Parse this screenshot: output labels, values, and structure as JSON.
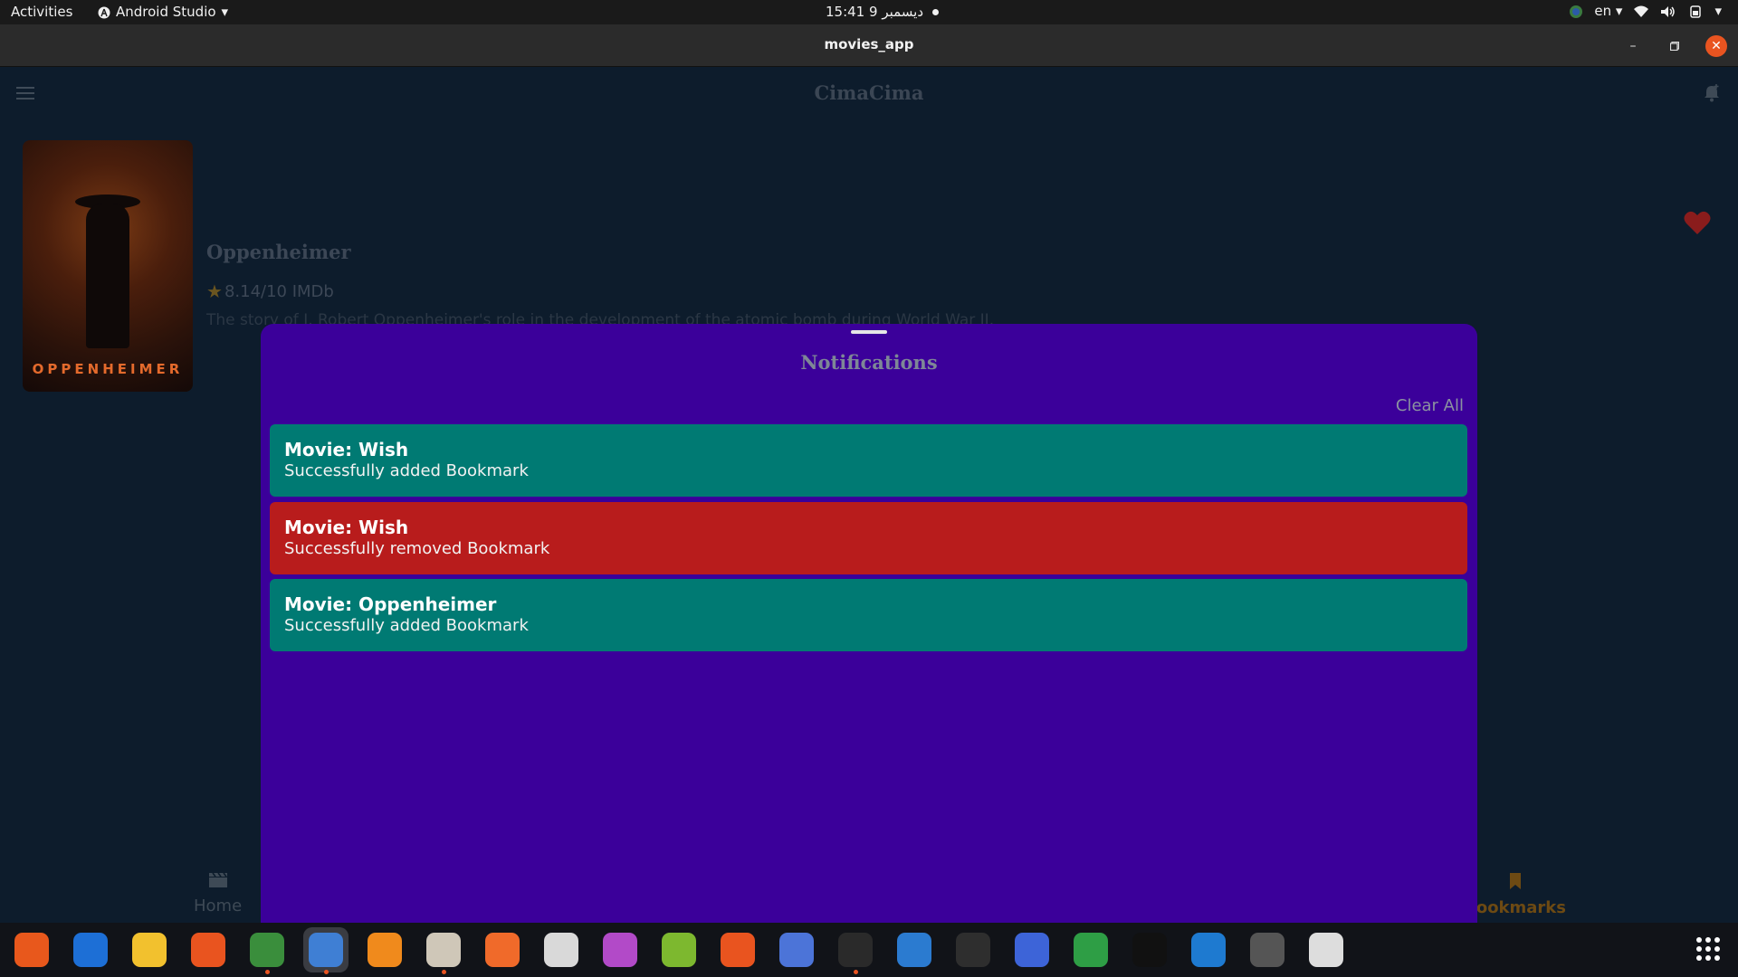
{
  "topbar": {
    "activities": "Activities",
    "app_menu": "Android Studio",
    "clock": "15:41  9 ديسمبر",
    "lang": "en"
  },
  "window": {
    "title": "movies_app"
  },
  "app": {
    "title": "CimaCima",
    "movie": {
      "title": "Oppenheimer",
      "rating": "8.14/10 IMDb",
      "description": "The story of J. Robert Oppenheimer's role in the development of the atomic bomb during World War II.",
      "poster_text": "OPPENHEIMER"
    },
    "nav": {
      "home": "Home",
      "bookmarks": "Bookmarks"
    }
  },
  "sheet": {
    "title": "Notifications",
    "clear_all": "Clear All",
    "notifications": [
      {
        "title": "Movie: Wish",
        "message": "Successfully added Bookmark",
        "type": "added"
      },
      {
        "title": "Movie: Wish",
        "message": "Successfully removed Bookmark",
        "type": "removed"
      },
      {
        "title": "Movie: Oppenheimer",
        "message": "Successfully added Bookmark",
        "type": "added"
      }
    ]
  },
  "colors": {
    "app_bg": "#0d1c2c",
    "sheet_bg": "#3b009a",
    "added": "#007a73",
    "removed": "#b81c1c",
    "heart": "#8a1c1c",
    "bookmark_active": "#6d4a13"
  },
  "dock": {
    "apps": [
      {
        "icon": "firefox-icon",
        "bg": "#e8581c"
      },
      {
        "icon": "thunderbird-icon",
        "bg": "#1d6fd6"
      },
      {
        "icon": "rhythmbox-icon",
        "bg": "#f2c12e"
      },
      {
        "icon": "software-center-icon",
        "bg": "#e9541f"
      },
      {
        "icon": "chrome-icon",
        "bg": "#3a8e3c"
      },
      {
        "icon": "android-studio-icon",
        "bg": "#3f7fd4"
      },
      {
        "icon": "vlc-icon",
        "bg": "#f08a1c"
      },
      {
        "icon": "files-icon",
        "bg": "#cfc7b8"
      },
      {
        "icon": "draw-icon",
        "bg": "#f06a2a"
      },
      {
        "icon": "document-viewer-icon",
        "bg": "#d9d9d9"
      },
      {
        "icon": "video-player-icon",
        "bg": "#b24ac8"
      },
      {
        "icon": "android-icon",
        "bg": "#7db82f"
      },
      {
        "icon": "ubuntu-icon",
        "bg": "#e9541f"
      },
      {
        "icon": "tasks-icon",
        "bg": "#4c74d8"
      },
      {
        "icon": "camera-icon",
        "bg": "#2a2a2a"
      },
      {
        "icon": "writer-icon",
        "bg": "#2b7bd0"
      },
      {
        "icon": "terminal-icon",
        "bg": "#2e2e2e"
      },
      {
        "icon": "screenshot-icon",
        "bg": "#3d64d8"
      },
      {
        "icon": "calc-icon",
        "bg": "#2e9e45"
      },
      {
        "icon": "intellij-icon",
        "bg": "#111111"
      },
      {
        "icon": "vscode-icon",
        "bg": "#1e7ad0"
      },
      {
        "icon": "update-icon",
        "bg": "#555555"
      },
      {
        "icon": "ipod-icon",
        "bg": "#dddddd"
      }
    ]
  }
}
